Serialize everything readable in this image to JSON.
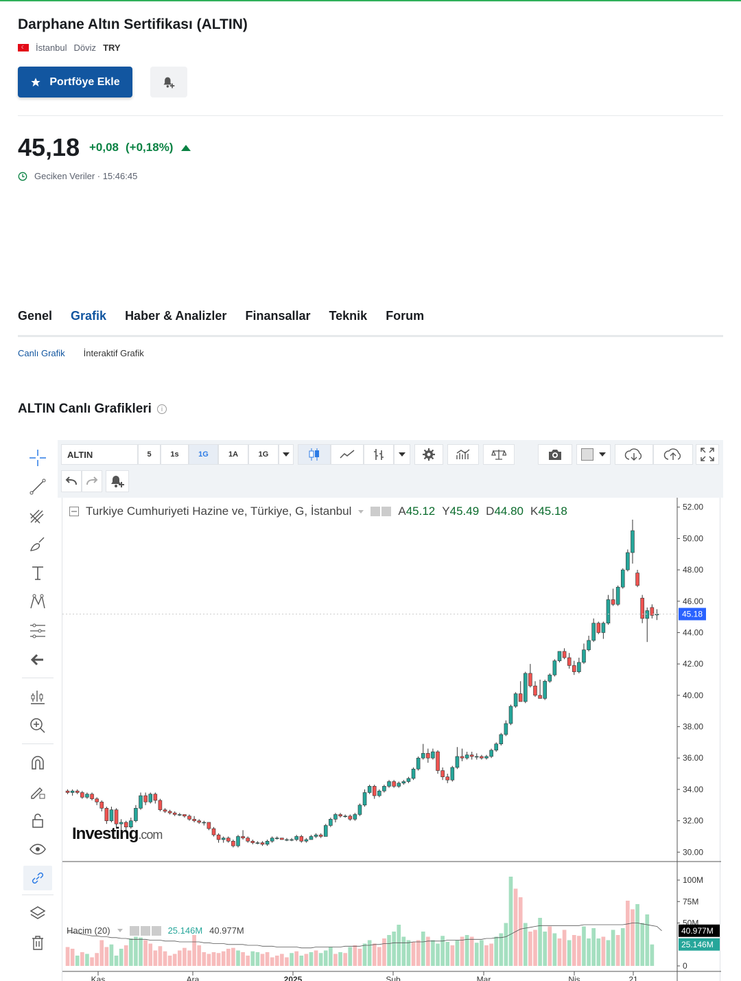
{
  "title": "Darphane Altın Sertifikası (ALTIN)",
  "meta": {
    "exchange": "İstanbul",
    "type_label": "Döviz",
    "currency": "TRY"
  },
  "buttons": {
    "portfolio": "Portföye Ekle"
  },
  "quote": {
    "last": "45,18",
    "change": "+0,08",
    "change_pct": "(+0,18%)",
    "delay_label": "Geciken Veriler · 15:46:45"
  },
  "tabs": [
    {
      "label": "Genel"
    },
    {
      "label": "Grafik"
    },
    {
      "label": "Haber & Analizler"
    },
    {
      "label": "Finansallar"
    },
    {
      "label": "Teknik"
    },
    {
      "label": "Forum"
    }
  ],
  "subtabs": [
    {
      "label": "Canlı Grafik"
    },
    {
      "label": "İnteraktif Grafik"
    }
  ],
  "section_title": "ALTIN Canlı Grafikleri",
  "colors": {
    "brand_blue": "#1256a0",
    "up_green": "#0a8243",
    "candle_up": "#26a69a",
    "candle_down": "#ef5350",
    "vol_up": "#a5dfc0",
    "vol_down": "#f7bcbc"
  },
  "toolbar": {
    "symbol": "ALTIN",
    "intervals": [
      "5",
      "1s",
      "1G",
      "1A",
      "1G"
    ],
    "active_interval": "1G"
  },
  "chart_legend": {
    "name": "Turkiye Cumhuriyeti Hazine ve, Türkiye, G, İstanbul",
    "open_label": "A",
    "open": "45.12",
    "high_label": "Y",
    "high": "45.49",
    "low_label": "D",
    "low": "44.80",
    "close_label": "K",
    "close": "45.18"
  },
  "volume_legend": {
    "name": "Hacim (20)",
    "volume": "25.146M",
    "ma": "40.977M"
  },
  "watermark": {
    "brand": "Investing",
    "suffix": ".com"
  },
  "chart_data": {
    "type": "candlestick",
    "price_axis": {
      "ticks": [
        "52.00",
        "50.00",
        "48.00",
        "46.00",
        "44.00",
        "42.00",
        "40.00",
        "38.00",
        "36.00",
        "34.00",
        "32.00",
        "30.00"
      ],
      "range": [
        29.4,
        52.6
      ]
    },
    "last_price_tag": "45.18",
    "x_ticks": [
      "Kas",
      "Ara",
      "2025",
      "Şub",
      "Mar",
      "Nis",
      "21"
    ],
    "volume_axis": {
      "ticks": [
        "100M",
        "75M",
        "50M",
        "0"
      ],
      "max": 104
    },
    "volume_tags": {
      "ma": "40.977M",
      "volume": "25.146M"
    },
    "candles": [
      [
        33.9,
        34.0,
        33.7,
        33.8
      ],
      [
        33.8,
        34.0,
        33.6,
        33.9
      ],
      [
        33.9,
        34.0,
        33.7,
        33.8
      ],
      [
        33.8,
        33.9,
        33.4,
        33.5
      ],
      [
        33.5,
        33.8,
        33.4,
        33.7
      ],
      [
        33.7,
        33.8,
        33.3,
        33.4
      ],
      [
        33.4,
        33.5,
        33.0,
        33.2
      ],
      [
        33.2,
        33.3,
        32.6,
        32.8
      ],
      [
        32.8,
        32.9,
        31.8,
        32.0
      ],
      [
        32.0,
        32.9,
        31.9,
        32.7
      ],
      [
        32.7,
        32.8,
        31.5,
        31.8
      ],
      [
        31.8,
        32.1,
        31.3,
        31.9
      ],
      [
        31.9,
        32.0,
        31.4,
        31.6
      ],
      [
        31.6,
        32.2,
        31.5,
        32.0
      ],
      [
        32.0,
        33.0,
        31.9,
        32.8
      ],
      [
        32.8,
        33.8,
        32.7,
        33.6
      ],
      [
        33.6,
        33.8,
        33.0,
        33.2
      ],
      [
        33.2,
        33.8,
        33.1,
        33.7
      ],
      [
        33.7,
        33.8,
        33.1,
        33.3
      ],
      [
        33.3,
        33.4,
        32.6,
        32.7
      ],
      [
        32.7,
        32.8,
        32.5,
        32.6
      ],
      [
        32.6,
        32.7,
        32.4,
        32.5
      ],
      [
        32.5,
        32.6,
        32.3,
        32.4
      ],
      [
        32.4,
        32.5,
        32.3,
        32.4
      ],
      [
        32.4,
        32.4,
        32.2,
        32.3
      ],
      [
        32.3,
        32.4,
        32.0,
        32.1
      ],
      [
        32.1,
        32.3,
        31.9,
        32.0
      ],
      [
        32.0,
        32.1,
        31.8,
        31.9
      ],
      [
        31.9,
        32.0,
        31.7,
        31.9
      ],
      [
        31.9,
        31.9,
        31.4,
        31.5
      ],
      [
        31.5,
        31.6,
        31.0,
        31.1
      ],
      [
        31.1,
        31.2,
        30.6,
        30.8
      ],
      [
        30.8,
        31.0,
        30.6,
        30.9
      ],
      [
        30.9,
        31.0,
        30.6,
        30.7
      ],
      [
        30.7,
        30.8,
        30.3,
        30.4
      ],
      [
        30.4,
        31.1,
        30.3,
        31.0
      ],
      [
        31.0,
        31.4,
        30.8,
        30.9
      ],
      [
        30.9,
        31.0,
        30.6,
        30.7
      ],
      [
        30.7,
        30.8,
        30.5,
        30.6
      ],
      [
        30.6,
        30.7,
        30.5,
        30.6
      ],
      [
        30.6,
        30.7,
        30.4,
        30.5
      ],
      [
        30.5,
        30.8,
        30.4,
        30.7
      ],
      [
        30.7,
        31.0,
        30.6,
        30.9
      ],
      [
        30.9,
        31.0,
        30.8,
        30.9
      ],
      [
        30.9,
        30.9,
        30.8,
        30.8
      ],
      [
        30.8,
        30.9,
        30.7,
        30.8
      ],
      [
        30.8,
        30.9,
        30.7,
        30.8
      ],
      [
        30.8,
        31.1,
        30.7,
        31.0
      ],
      [
        31.0,
        31.1,
        30.6,
        30.7
      ],
      [
        30.7,
        30.9,
        30.6,
        30.8
      ],
      [
        30.8,
        31.1,
        30.8,
        31.0
      ],
      [
        31.0,
        31.2,
        30.9,
        31.1
      ],
      [
        31.1,
        31.2,
        30.9,
        31.0
      ],
      [
        31.0,
        31.8,
        31.0,
        31.7
      ],
      [
        31.7,
        32.2,
        31.6,
        32.1
      ],
      [
        32.1,
        32.5,
        31.9,
        32.4
      ],
      [
        32.4,
        32.5,
        32.2,
        32.3
      ],
      [
        32.3,
        32.4,
        32.2,
        32.3
      ],
      [
        32.3,
        32.4,
        32.0,
        32.1
      ],
      [
        32.1,
        32.5,
        32.0,
        32.4
      ],
      [
        32.4,
        33.1,
        32.3,
        33.0
      ],
      [
        33.0,
        34.0,
        32.9,
        33.8
      ],
      [
        33.8,
        34.3,
        33.7,
        34.2
      ],
      [
        34.2,
        34.3,
        33.4,
        33.6
      ],
      [
        33.6,
        34.0,
        33.5,
        33.9
      ],
      [
        33.9,
        34.3,
        33.8,
        34.2
      ],
      [
        34.2,
        34.6,
        34.1,
        34.5
      ],
      [
        34.5,
        34.6,
        34.1,
        34.2
      ],
      [
        34.2,
        34.5,
        34.1,
        34.4
      ],
      [
        34.4,
        34.6,
        34.3,
        34.5
      ],
      [
        34.5,
        34.8,
        34.4,
        34.7
      ],
      [
        34.7,
        35.4,
        34.6,
        35.3
      ],
      [
        35.3,
        36.1,
        35.2,
        36.0
      ],
      [
        36.0,
        36.9,
        35.9,
        36.3
      ],
      [
        36.3,
        36.6,
        35.7,
        36.0
      ],
      [
        36.0,
        36.6,
        35.9,
        36.4
      ],
      [
        36.4,
        36.5,
        35.0,
        35.2
      ],
      [
        35.2,
        35.4,
        34.6,
        34.8
      ],
      [
        34.8,
        35.0,
        34.4,
        34.6
      ],
      [
        34.6,
        35.5,
        34.5,
        35.4
      ],
      [
        35.4,
        36.7,
        35.3,
        36.1
      ],
      [
        36.1,
        36.6,
        35.8,
        36.0
      ],
      [
        36.0,
        36.4,
        35.9,
        36.2
      ],
      [
        36.2,
        36.4,
        35.9,
        36.1
      ],
      [
        36.1,
        36.3,
        35.9,
        36.1
      ],
      [
        36.1,
        36.2,
        35.9,
        36.0
      ],
      [
        36.0,
        36.2,
        35.9,
        36.1
      ],
      [
        36.1,
        36.6,
        36.0,
        36.5
      ],
      [
        36.5,
        37.0,
        36.4,
        36.9
      ],
      [
        36.9,
        37.6,
        36.8,
        37.5
      ],
      [
        37.5,
        38.4,
        37.4,
        38.2
      ],
      [
        38.2,
        39.4,
        38.1,
        39.3
      ],
      [
        39.3,
        40.2,
        39.2,
        40.1
      ],
      [
        40.1,
        40.9,
        39.9,
        39.6
      ],
      [
        39.6,
        41.5,
        39.5,
        41.4
      ],
      [
        41.4,
        42.0,
        40.5,
        40.6
      ],
      [
        40.6,
        40.9,
        39.9,
        40.0
      ],
      [
        40.0,
        41.0,
        39.8,
        39.8
      ],
      [
        39.8,
        41.0,
        39.7,
        40.9
      ],
      [
        40.9,
        41.4,
        40.8,
        41.3
      ],
      [
        41.3,
        42.3,
        41.2,
        42.2
      ],
      [
        42.2,
        42.8,
        42.1,
        42.8
      ],
      [
        42.8,
        43.0,
        42.3,
        42.4
      ],
      [
        42.4,
        42.7,
        41.7,
        41.9
      ],
      [
        41.9,
        42.2,
        41.3,
        41.5
      ],
      [
        41.5,
        42.4,
        41.4,
        42.1
      ],
      [
        42.1,
        43.3,
        42.0,
        42.9
      ],
      [
        42.9,
        43.8,
        42.8,
        43.5
      ],
      [
        43.5,
        44.9,
        43.4,
        44.6
      ],
      [
        44.6,
        44.7,
        43.9,
        44.0
      ],
      [
        44.0,
        44.7,
        43.6,
        44.6
      ],
      [
        44.6,
        46.4,
        44.5,
        46.1
      ],
      [
        46.1,
        46.8,
        45.7,
        45.8
      ],
      [
        45.8,
        47.0,
        45.7,
        46.9
      ],
      [
        46.9,
        48.1,
        46.8,
        48.0
      ],
      [
        48.0,
        49.3,
        47.9,
        49.1
      ],
      [
        49.1,
        51.2,
        48.4,
        50.5
      ],
      [
        47.8,
        48.0,
        46.9,
        47.0
      ],
      [
        46.2,
        46.4,
        44.6,
        44.9
      ],
      [
        44.9,
        45.6,
        43.4,
        45.4
      ],
      [
        45.6,
        45.8,
        44.9,
        45.1
      ],
      [
        45.12,
        45.49,
        44.8,
        45.18
      ]
    ],
    "volumes": [
      [
        22,
        1
      ],
      [
        20,
        1
      ],
      [
        12,
        0
      ],
      [
        16,
        1
      ],
      [
        14,
        0
      ],
      [
        10,
        1
      ],
      [
        15,
        1
      ],
      [
        30,
        1
      ],
      [
        22,
        1
      ],
      [
        25,
        0
      ],
      [
        12,
        0
      ],
      [
        20,
        0
      ],
      [
        24,
        1
      ],
      [
        32,
        0
      ],
      [
        34,
        0
      ],
      [
        33,
        0
      ],
      [
        30,
        1
      ],
      [
        26,
        1
      ],
      [
        18,
        1
      ],
      [
        23,
        1
      ],
      [
        17,
        1
      ],
      [
        12,
        1
      ],
      [
        14,
        1
      ],
      [
        18,
        1
      ],
      [
        21,
        1
      ],
      [
        18,
        1
      ],
      [
        36,
        1
      ],
      [
        24,
        1
      ],
      [
        16,
        1
      ],
      [
        14,
        1
      ],
      [
        16,
        1
      ],
      [
        15,
        1
      ],
      [
        17,
        1
      ],
      [
        20,
        1
      ],
      [
        21,
        1
      ],
      [
        18,
        0
      ],
      [
        16,
        1
      ],
      [
        12,
        1
      ],
      [
        17,
        0
      ],
      [
        16,
        0
      ],
      [
        14,
        1
      ],
      [
        16,
        1
      ],
      [
        10,
        1
      ],
      [
        12,
        1
      ],
      [
        14,
        1
      ],
      [
        10,
        1
      ],
      [
        15,
        0
      ],
      [
        17,
        1
      ],
      [
        12,
        0
      ],
      [
        14,
        1
      ],
      [
        16,
        0
      ],
      [
        18,
        1
      ],
      [
        15,
        0
      ],
      [
        18,
        0
      ],
      [
        22,
        0
      ],
      [
        14,
        1
      ],
      [
        16,
        0
      ],
      [
        15,
        1
      ],
      [
        22,
        0
      ],
      [
        24,
        1
      ],
      [
        20,
        1
      ],
      [
        26,
        0
      ],
      [
        30,
        0
      ],
      [
        26,
        1
      ],
      [
        22,
        1
      ],
      [
        32,
        1
      ],
      [
        36,
        0
      ],
      [
        40,
        0
      ],
      [
        48,
        0
      ],
      [
        34,
        0
      ],
      [
        30,
        0
      ],
      [
        28,
        1
      ],
      [
        30,
        1
      ],
      [
        40,
        0
      ],
      [
        34,
        1
      ],
      [
        30,
        0
      ],
      [
        26,
        0
      ],
      [
        35,
        0
      ],
      [
        28,
        0
      ],
      [
        24,
        1
      ],
      [
        30,
        0
      ],
      [
        34,
        1
      ],
      [
        36,
        0
      ],
      [
        34,
        1
      ],
      [
        27,
        0
      ],
      [
        30,
        0
      ],
      [
        24,
        1
      ],
      [
        26,
        1
      ],
      [
        34,
        0
      ],
      [
        38,
        0
      ],
      [
        50,
        0
      ],
      [
        104,
        0
      ],
      [
        90,
        1
      ],
      [
        80,
        1
      ],
      [
        50,
        0
      ],
      [
        40,
        1
      ],
      [
        42,
        1
      ],
      [
        56,
        0
      ],
      [
        40,
        0
      ],
      [
        46,
        1
      ],
      [
        38,
        0
      ],
      [
        32,
        1
      ],
      [
        42,
        1
      ],
      [
        30,
        0
      ],
      [
        36,
        1
      ],
      [
        35,
        1
      ],
      [
        46,
        0
      ],
      [
        32,
        0
      ],
      [
        44,
        0
      ],
      [
        32,
        0
      ],
      [
        34,
        1
      ],
      [
        30,
        0
      ],
      [
        42,
        0
      ],
      [
        36,
        1
      ],
      [
        44,
        0
      ],
      [
        76,
        1
      ],
      [
        66,
        1
      ],
      [
        72,
        0
      ],
      [
        50,
        0
      ],
      [
        60,
        0
      ],
      [
        25,
        0
      ]
    ],
    "ma": [
      40,
      39,
      38,
      37,
      36,
      35,
      35,
      34,
      34,
      33,
      33,
      32,
      32,
      31,
      31,
      31,
      31,
      30,
      30,
      30,
      29,
      29,
      29,
      28,
      28,
      28,
      28,
      28,
      27,
      27,
      26,
      26,
      26,
      25,
      25,
      25,
      25,
      24,
      24,
      24,
      23,
      23,
      23,
      22,
      22,
      22,
      22,
      22,
      21,
      21,
      21,
      22,
      22,
      22,
      22,
      22,
      22,
      23,
      23,
      23,
      23,
      24,
      24,
      25,
      25,
      26,
      26,
      27,
      27,
      27,
      27,
      28,
      28,
      28,
      29,
      29,
      29,
      29,
      30,
      30,
      30,
      30,
      31,
      31,
      31,
      31,
      32,
      32,
      33,
      33,
      34,
      37,
      40,
      43,
      44,
      45,
      46,
      47,
      47,
      47,
      47,
      47,
      47,
      47,
      47,
      47,
      48,
      48,
      48,
      48,
      48,
      48,
      48,
      48,
      48,
      49,
      50,
      50,
      49,
      48,
      47,
      46,
      41
    ]
  }
}
